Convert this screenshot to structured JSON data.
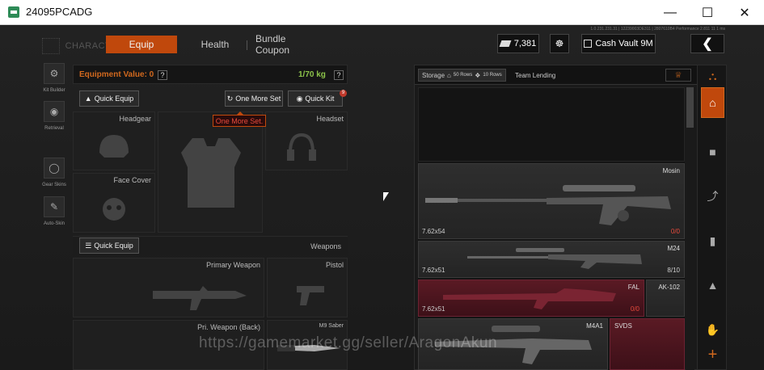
{
  "window": {
    "title": "24095PCADG",
    "min": "—",
    "max": "☐",
    "close": "✕"
  },
  "nav": {
    "character": "CHARACTER",
    "tabs": [
      {
        "label": "Equip",
        "active": true
      },
      {
        "label": "Health",
        "active": false
      },
      {
        "label": "Bundle Coupon",
        "active": false
      }
    ],
    "currency": "7,381",
    "cash_vault": "Cash Vault 9M",
    "back_icon": "back-arrow-icon",
    "version_text": "1.0.231.231.31 | 12239003DE311 | 2807610B4 Performance 2.811 11 1 ms"
  },
  "sidebar": {
    "items": [
      {
        "label": "Kit Builder",
        "icon": "kit-builder-icon"
      },
      {
        "label": "Retrieval",
        "icon": "retrieval-icon"
      },
      {
        "label": "Gear Skins",
        "icon": "gear-skins-icon"
      },
      {
        "label": "Auto-Skin",
        "icon": "auto-skin-icon"
      }
    ]
  },
  "equipment": {
    "value_label": "Equipment Value: 0",
    "weight": "1/70 kg",
    "help": "?",
    "quick_equip": "Quick Equip",
    "one_more_set": "One More Set",
    "quick_kit": "Quick Kit",
    "quick_kit_badge": "9",
    "tooltip": "One More Set.",
    "slots": {
      "headgear": "Headgear",
      "headset": "Headset",
      "face_cover": "Face Cover",
      "weapons": "Weapons",
      "quick_equip_weapons": "Quick Equip",
      "primary": "Primary Weapon",
      "pistol": "Pistol",
      "primary_back": "Pri. Weapon (Back)",
      "melee": "M9 Saber"
    }
  },
  "storage": {
    "tab_storage": "Storage",
    "rows_50": "50 Rows",
    "rows_10": "10 Rows",
    "team_lending": "Team Lending",
    "items": [
      {
        "name": "Mosin",
        "ammo": "7.62x54",
        "count": "0/0"
      },
      {
        "name": "M24",
        "ammo": "7.62x51",
        "count": "8/10"
      },
      {
        "name": "FAL",
        "ammo": "7.62x51",
        "count": "0/0"
      },
      {
        "name": "AK-102",
        "ammo": "",
        "count": ""
      },
      {
        "name": "M4A1",
        "ammo": "",
        "count": ""
      },
      {
        "name": "SVDS",
        "ammo": "",
        "count": ""
      }
    ]
  },
  "rail": [
    "storage-settings-icon",
    "home-icon",
    "vest-icon",
    "rifle-icon",
    "magazine-icon",
    "ammo-icon",
    "hand-icon",
    "plus-icon"
  ],
  "watermark": "https://gamemarket.gg/seller/AragonAkun",
  "colors": {
    "accent": "#c0480c",
    "weight_green": "#8cc34a",
    "value_orange": "#d2691e",
    "red_item": "#5a1a24"
  }
}
